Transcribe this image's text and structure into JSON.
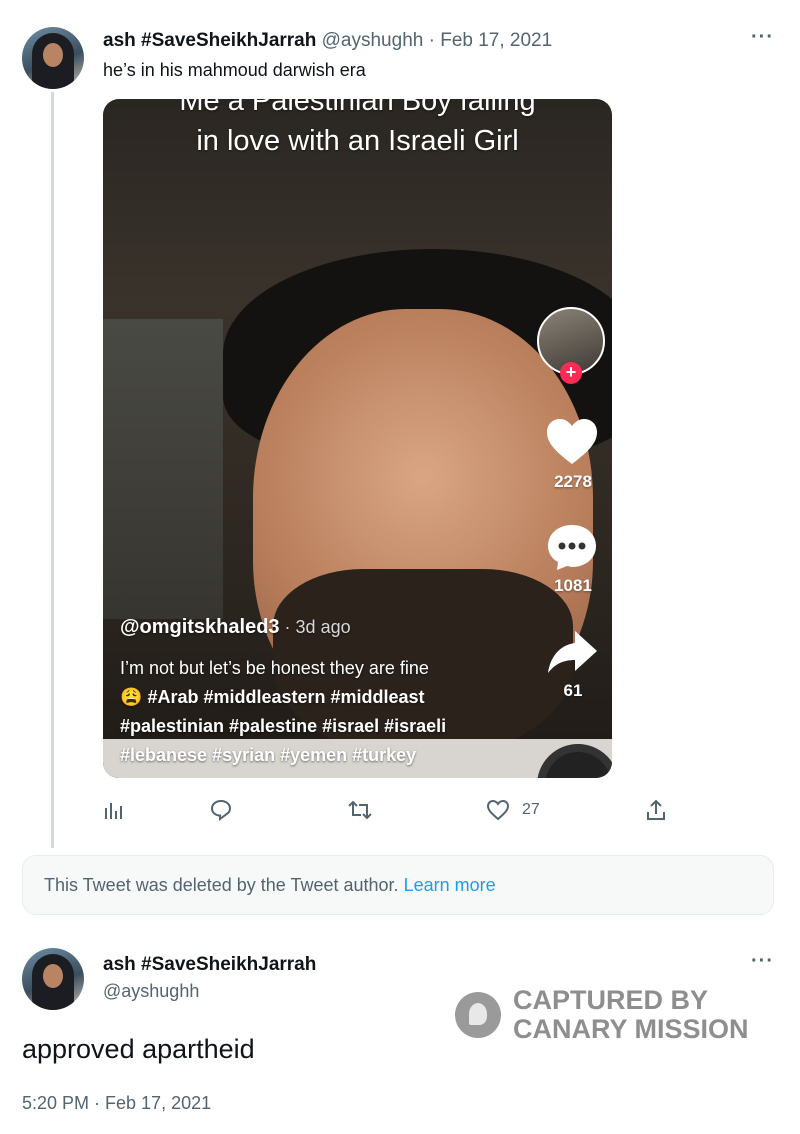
{
  "tweet1": {
    "display_name": "ash #SaveSheikhJarrah",
    "handle_date": "@ayshughh · Feb 17, 2021",
    "text": "he’s in his mahmoud darwish era",
    "media": {
      "title_cut": "Me a Palestinian Boy falling",
      "title": "in love with an Israeli Girl",
      "like_count": "2278",
      "comment_count": "1081",
      "share_count": "61",
      "creator_handle": "@omgitskhaled3",
      "posted_age": " · 3d ago",
      "caption_line1": "I’m not but let’s be honest they are fine",
      "caption_emoji": "😩",
      "caption_tags_line1": "#Arab #middleastern #middleast",
      "caption_tags_line2": "#palestinian #palestine #israel #israeli",
      "caption_tags_line3": "#lebanese #syrian #yemen #turkey"
    },
    "actions": {
      "likes": "27"
    }
  },
  "deleted_notice": {
    "text": "This Tweet was deleted by the Tweet author.",
    "link": "Learn more"
  },
  "tweet2": {
    "display_name": "ash #SaveSheikhJarrah",
    "handle": "@ayshughh",
    "text": "approved apartheid",
    "timestamp": "5:20 PM · Feb 17, 2021"
  },
  "watermark": {
    "line1": "CAPTURED BY",
    "line2": "CANARY MISSION"
  },
  "icons": [
    "more-icon",
    "analytics-icon",
    "reply-icon",
    "retweet-icon",
    "like-icon",
    "share-icon",
    "tiktok-heart-icon",
    "tiktok-comment-icon",
    "tiktok-share-icon"
  ],
  "colors": {
    "link": "#1d9bf0",
    "muted": "#536471",
    "text": "#0f1419",
    "tiktok_follow": "#fe2c55"
  }
}
